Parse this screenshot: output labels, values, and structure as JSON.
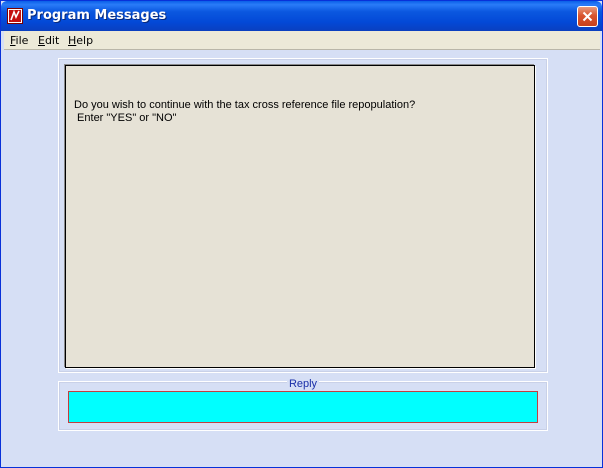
{
  "window": {
    "title": "Program Messages"
  },
  "menu": {
    "items": [
      "File",
      "Edit",
      "Help"
    ]
  },
  "message": {
    "text": "Do you wish to continue with the tax cross reference file repopulation?\n Enter \"YES\" or \"NO\""
  },
  "reply": {
    "label": "Reply",
    "value": ""
  },
  "colors": {
    "titlebar": "#0349d7",
    "client_bg": "#d6dff5",
    "message_bg": "#e6e2d6",
    "reply_bg": "#00ffff",
    "reply_border": "#c04040",
    "reply_label": "#1a2fa8"
  }
}
